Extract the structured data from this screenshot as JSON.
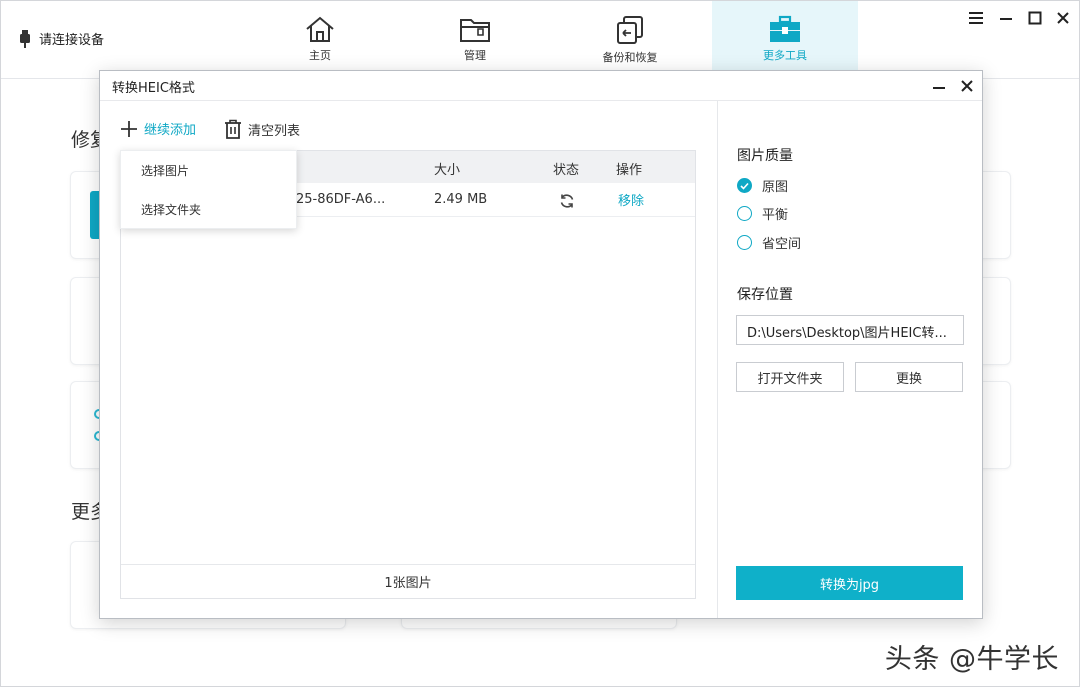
{
  "app": {
    "device_status": "请连接设备",
    "nav": [
      {
        "label": "主页",
        "icon": "home-icon"
      },
      {
        "label": "管理",
        "icon": "folder-icon"
      },
      {
        "label": "备份和恢复",
        "icon": "backup-restore-icon"
      },
      {
        "label": "更多工具",
        "icon": "toolbox-icon"
      }
    ],
    "active_nav": "更多工具",
    "background": {
      "heading_1": "修复",
      "heading_2": "更多"
    }
  },
  "dialog": {
    "title": "转换HEIC格式",
    "toolbar": {
      "add_label": "继续添加",
      "clear_label": "清空列表"
    },
    "dropdown": {
      "items": [
        "选择图片",
        "选择文件夹"
      ]
    },
    "table": {
      "columns": [
        "大小",
        "状态",
        "操作"
      ],
      "rows": [
        {
          "name": "25-86DF-A6...",
          "size": "2.49 MB",
          "status_icon": "refresh-icon",
          "action": "移除"
        }
      ],
      "footer": "1张图片"
    },
    "quality": {
      "heading": "图片质量",
      "options": [
        {
          "label": "原图",
          "checked": true
        },
        {
          "label": "平衡",
          "checked": false
        },
        {
          "label": "省空间",
          "checked": false
        }
      ]
    },
    "save": {
      "heading": "保存位置",
      "path": "D:\\Users\\Desktop\\图片HEIC转...",
      "open_folder": "打开文件夹",
      "change": "更换"
    },
    "convert_label": "转换为jpg"
  },
  "watermark": "头条 @牛学长",
  "colors": {
    "accent": "#0fa8c5",
    "active_tab_bg": "#e6f6fa"
  }
}
